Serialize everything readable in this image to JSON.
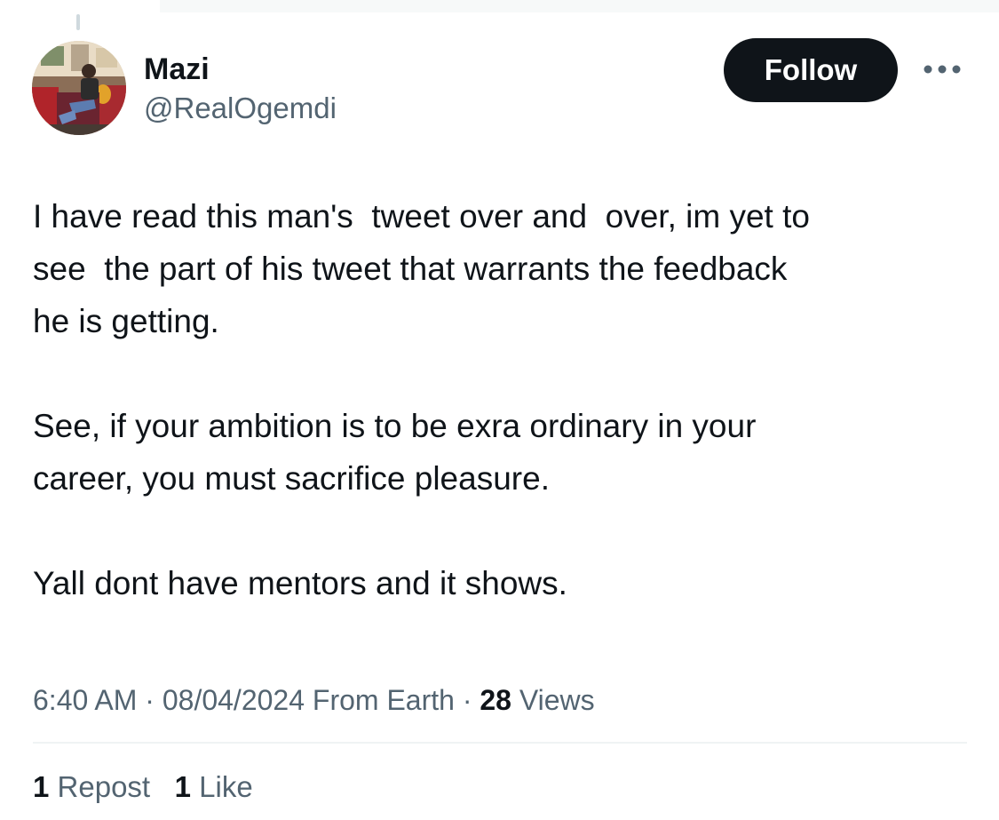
{
  "header": {
    "display_name": "Mazi",
    "handle": "@RealOgemdi",
    "follow_label": "Follow",
    "more_icon": "more-horizontal-icon"
  },
  "tweet": {
    "paragraphs": [
      {
        "lines": [
          "I have read this man's  tweet over and  over, im yet to",
          "see  the part of his tweet that warrants the feedback",
          "he is getting."
        ]
      },
      {
        "lines": [
          "See, if your ambition is to be exra ordinary in your",
          "career, you must sacrifice pleasure."
        ]
      },
      {
        "lines": [
          "Yall dont have mentors and it shows."
        ]
      }
    ]
  },
  "meta": {
    "time": "6:40 AM",
    "separator": " · ",
    "date": "08/04/2024",
    "source": " From Earth",
    "views_count": "28",
    "views_label": " Views"
  },
  "stats": {
    "reposts_count": "1",
    "reposts_label": " Repost",
    "likes_count": "1",
    "likes_label": " Like"
  },
  "colors": {
    "text_primary": "#0f1419",
    "text_secondary": "#536471",
    "follow_bg": "#0f1419",
    "divider": "#eff3f4"
  }
}
